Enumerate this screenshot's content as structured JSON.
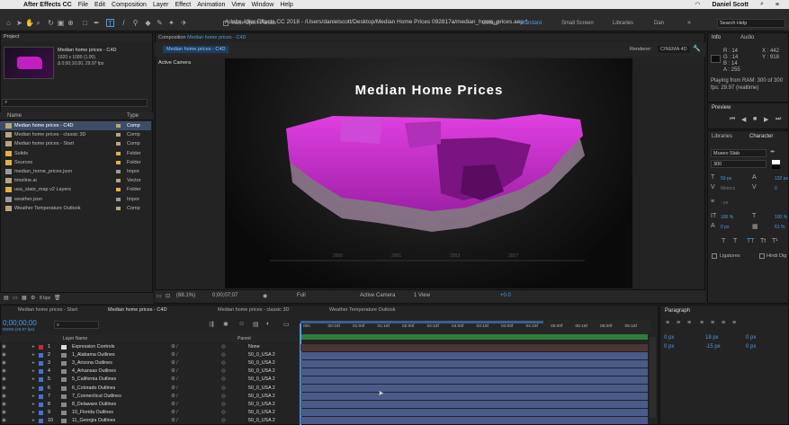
{
  "menubar": {
    "app": "After Effects CC",
    "items": [
      "File",
      "Edit",
      "Composition",
      "Layer",
      "Effect",
      "Animation",
      "View",
      "Window",
      "Help"
    ],
    "user": "Daniel Scott"
  },
  "title": "Adobe After Effects CC 2018 - /Users/danielscott/Desktop/Median Home Prices 092817a/median_home_prices.aep *",
  "auto_open": "Auto-Open Panels",
  "workspaces": [
    "Default",
    "Standard",
    "Small Screen",
    "Libraries",
    "Dan"
  ],
  "search_help": "Search Help",
  "project": {
    "tab": "Project",
    "selected_name": "Median home prices - C4D",
    "selected_info": [
      "1920 x 1080 (1.00)",
      "Δ 0;00;10;00, 29.97 fps"
    ],
    "col_name": "Name",
    "col_type": "Type",
    "items": [
      {
        "name": "Median home prices - C4D",
        "type": "Comp",
        "color": "#b8a57d",
        "selected": true
      },
      {
        "name": "Median home prices - classic 3D",
        "type": "Comp",
        "color": "#b8a57d"
      },
      {
        "name": "Median home prices - Start",
        "type": "Comp",
        "color": "#b8a57d"
      },
      {
        "name": "Solids",
        "type": "Folder",
        "color": "#e0b341"
      },
      {
        "name": "Sources",
        "type": "Folder",
        "color": "#e0b341"
      },
      {
        "name": "median_home_prices.json",
        "type": "Impor",
        "color": "#9a9a9a"
      },
      {
        "name": "timeline.ai",
        "type": "Vector",
        "color": "#b8a57d"
      },
      {
        "name": "usa_state_map v2 Layers",
        "type": "Folder",
        "color": "#e0b341"
      },
      {
        "name": "weather.json",
        "type": "Impor",
        "color": "#9a9a9a"
      },
      {
        "name": "Weather Temperature Outlook",
        "type": "Comp",
        "color": "#b8a57d"
      }
    ],
    "bpc": "8 bpc"
  },
  "composition": {
    "tab": "Composition",
    "name": "Median home prices - C4D",
    "subtab": "Median home prices - C4D",
    "renderer_label": "Renderer:",
    "renderer": "CINEMA 4D",
    "active_camera": "Active Camera",
    "viewer_title": "Median Home Prices",
    "ruler": [
      "2000",
      "2001",
      "2003",
      "2007"
    ]
  },
  "compbottom": {
    "zoom": "(88.1%)",
    "timecode": "0;00;07;07",
    "resolution": "Full",
    "view": "Active Camera",
    "views": "1 View",
    "exposure": "+0.0"
  },
  "info": {
    "tab": "Info",
    "tab2": "Audio",
    "R": "R : 14",
    "G": "G : 14",
    "B": "B : 14",
    "A": "A : 255",
    "X": "X : 442",
    "Y": "Y : 918",
    "playing": [
      "Playing from RAM: 300 of 300",
      "fps: 29.97 (realtime)"
    ]
  },
  "preview": {
    "tab": "Preview"
  },
  "character": {
    "tab1": "Libraries",
    "tab2": "Character",
    "font": "Museo Slab",
    "weight": "300",
    "size": "50 px",
    "leading": "132 px",
    "kern": "Metrics",
    "track": "0",
    "stroke": "- px",
    "vscale": "100 %",
    "hscale": "100 %",
    "baseline": "0 px",
    "tsume": "61 %",
    "ligatures": "Ligatures",
    "hindi": "Hindi Dig"
  },
  "timeline": {
    "tabs": [
      "Median home prices - Start",
      "Median home prices - C4D",
      "Median home prices - classic 3D",
      "Weather Temperature Outlook"
    ],
    "timecode": "0;00;00;00",
    "fps": "00000 (29.97 fps)",
    "col_layer": "Layer Name",
    "col_parent": "Parent",
    "ticks": [
      "00s",
      "00:15f",
      "01:00f",
      "01:15f",
      "02:00f",
      "02:15f",
      "03:00f",
      "03:15f",
      "04:00f",
      "04:15f",
      "05:00f",
      "05:15f",
      "06:00f",
      "06:15f"
    ],
    "layers": [
      {
        "num": "1",
        "name": "Expression Controls",
        "parent": "None",
        "color": "#c03030"
      },
      {
        "num": "2",
        "name": "1_Alabama Outlines",
        "parent": "50_0_USA 2",
        "color": "#4a6fd0"
      },
      {
        "num": "3",
        "name": "3_Arizona Outlines",
        "parent": "50_0_USA 2",
        "color": "#4a6fd0"
      },
      {
        "num": "4",
        "name": "4_Arkansas Outlines",
        "parent": "50_0_USA 2",
        "color": "#4a6fd0"
      },
      {
        "num": "5",
        "name": "5_California Outlines",
        "parent": "50_0_USA 2",
        "color": "#4a6fd0"
      },
      {
        "num": "6",
        "name": "6_Colorado Outlines",
        "parent": "50_0_USA 2",
        "color": "#4a6fd0"
      },
      {
        "num": "7",
        "name": "7_Connecticut Outlines",
        "parent": "50_0_USA 2",
        "color": "#4a6fd0"
      },
      {
        "num": "8",
        "name": "8_Delaware Outlines",
        "parent": "50_0_USA 2",
        "color": "#4a6fd0"
      },
      {
        "num": "9",
        "name": "10_Florida Outlines",
        "parent": "50_0_USA 2",
        "color": "#4a6fd0"
      },
      {
        "num": "10",
        "name": "11_Georgia Outlines",
        "parent": "50_0_USA 2",
        "color": "#4a6fd0"
      }
    ]
  },
  "paragraph": {
    "tab": "Paragraph",
    "indent_l": "0 px",
    "indent_r": "0 px",
    "indent_f": "0 px",
    "space_b": "18 px",
    "space_a": "-15 px",
    "space_a2": "0 px"
  }
}
